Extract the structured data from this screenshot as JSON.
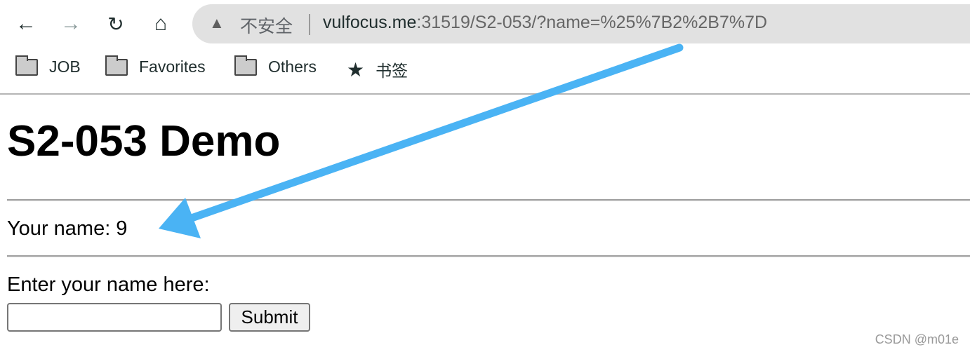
{
  "browser": {
    "back_icon": "arrow-left",
    "forward_icon": "arrow-right",
    "reload_icon": "reload",
    "home_icon": "home",
    "security_label": "不安全",
    "url_host": "vulfocus.me",
    "url_rest": ":31519/S2-053/?name=%25%7B2%2B7%7D"
  },
  "bookmarks": [
    {
      "label": "JOB",
      "icon": "folder"
    },
    {
      "label": "Favorites",
      "icon": "folder"
    },
    {
      "label": "Others",
      "icon": "folder"
    },
    {
      "label": "书签",
      "icon": "star"
    }
  ],
  "page": {
    "title": "S2-053 Demo",
    "result": "Your name: 9",
    "prompt": "Enter your name here:",
    "input_value": "",
    "submit_label": "Submit"
  },
  "annotation": {
    "arrow_color": "#4ab3f4"
  },
  "watermark": "CSDN @m01e"
}
